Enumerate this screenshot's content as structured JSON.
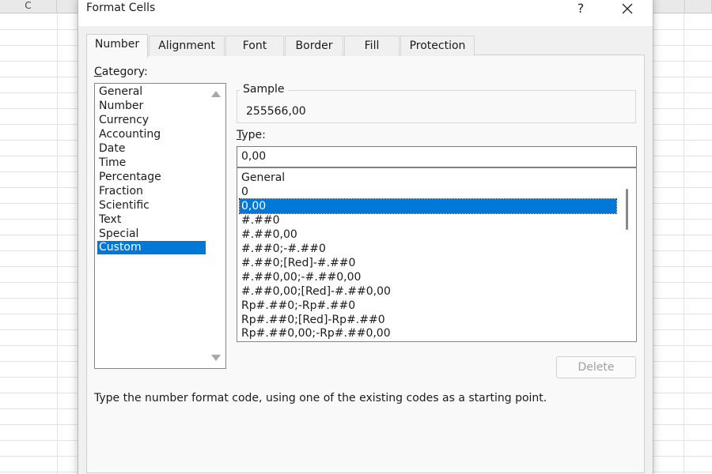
{
  "spreadsheet": {
    "column_c_label": "C"
  },
  "dialog": {
    "title": "Format Cells",
    "help_label": "?",
    "tabs": [
      {
        "label": "Number",
        "active": true
      },
      {
        "label": "Alignment",
        "active": false
      },
      {
        "label": "Font",
        "active": false
      },
      {
        "label": "Border",
        "active": false
      },
      {
        "label": "Fill",
        "active": false
      },
      {
        "label": "Protection",
        "active": false
      }
    ],
    "category": {
      "label_underlined": "C",
      "label_rest": "ategory:",
      "items": [
        "General",
        "Number",
        "Currency",
        "Accounting",
        "Date",
        "Time",
        "Percentage",
        "Fraction",
        "Scientific",
        "Text",
        "Special",
        "Custom"
      ],
      "selected": "Custom"
    },
    "sample": {
      "legend": "Sample",
      "value": "255566,00"
    },
    "type": {
      "label_underlined": "T",
      "label_rest": "ype:",
      "input_value": "0,00",
      "items": [
        "General",
        "0",
        "0,00",
        "#.##0",
        "#.##0,00",
        "#.##0;-#.##0",
        "#.##0;[Red]-#.##0",
        "#.##0,00;-#.##0,00",
        "#.##0,00;[Red]-#.##0,00",
        "Rp#.##0;-Rp#.##0",
        "Rp#.##0;[Red]-Rp#.##0",
        "Rp#.##0,00;-Rp#.##0,00"
      ],
      "selected": "0,00"
    },
    "delete_label": "Delete",
    "hint": "Type the number format code, using one of the existing codes as a starting point."
  },
  "colors": {
    "selection": "#0078d7",
    "dialog_bg": "#f0f0f0",
    "panel_bg": "#f9f9f9"
  }
}
